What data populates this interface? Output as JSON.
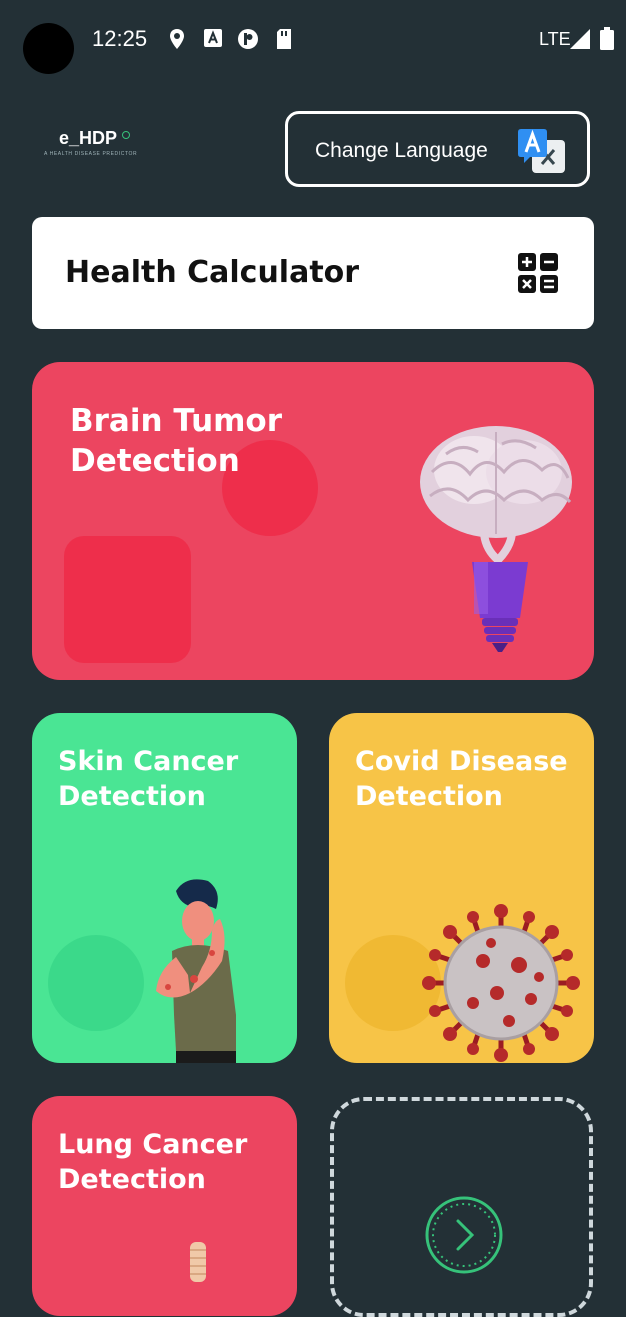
{
  "status_bar": {
    "time": "12:25",
    "network": "LTE",
    "icons": [
      "location-icon",
      "a-box-icon",
      "p-circle-icon",
      "sd-card-icon",
      "signal-icon",
      "battery-icon"
    ]
  },
  "header": {
    "logo_name": "e_HDP",
    "logo_tagline": "A HEALTH DISEASE PREDICTOR",
    "change_language_label": "Change Language"
  },
  "health_calculator": {
    "title": "Health Calculator"
  },
  "cards": {
    "brain": {
      "line1": "Brain Tumor",
      "line2": "Detection",
      "color": "#ec4560"
    },
    "skin": {
      "line1": "Skin Cancer",
      "line2": "Detection",
      "color": "#4ae594"
    },
    "covid": {
      "line1": "Covid Disease",
      "line2": "Detection",
      "color": "#f7c447"
    },
    "lung": {
      "line1": "Lung Cancer",
      "line2": "Detection",
      "color": "#ec4560"
    }
  },
  "colors": {
    "background": "#233036",
    "accent_green": "#36c27a"
  }
}
